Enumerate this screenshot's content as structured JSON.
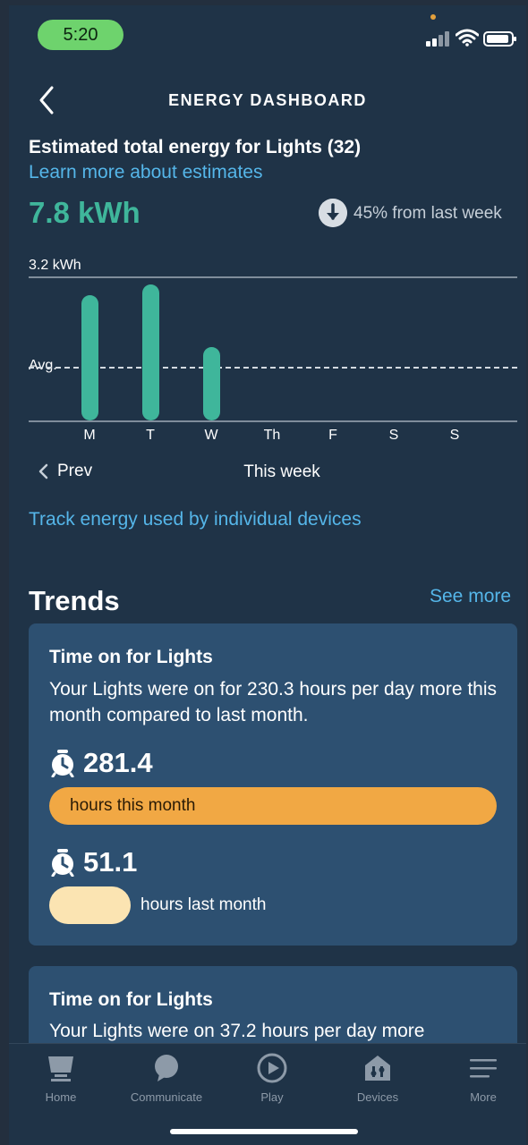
{
  "status_bar": {
    "time": "5:20"
  },
  "header": {
    "title": "ENERGY DASHBOARD"
  },
  "summary": {
    "title": "Estimated total energy for Lights (32)",
    "learn_link": "Learn more about estimates",
    "total": "7.8 kWh",
    "change_text": "45% from last week",
    "change_direction": "down"
  },
  "chart_data": {
    "type": "bar",
    "title": "",
    "max_label": "3.2 kWh",
    "avg_label": "Avg.",
    "categories": [
      "M",
      "T",
      "W",
      "Th",
      "F",
      "S",
      "S"
    ],
    "values": [
      2.8,
      3.05,
      1.65,
      0,
      0,
      0,
      0
    ],
    "average": 1.2,
    "ylim": [
      0,
      3.2
    ],
    "color": "#3fb69b"
  },
  "chart_nav": {
    "prev_label": "Prev",
    "period_label": "This week"
  },
  "track_link": "Track energy used by individual devices",
  "trends": {
    "title": "Trends",
    "see_more": "See more",
    "cards": [
      {
        "title": "Time on for Lights",
        "body": "Your Lights were on for 230.3 hours per day more this month compared to last month.",
        "this_value": "281.4",
        "this_label": "hours this month",
        "last_value": "51.1",
        "last_label": "hours last month"
      },
      {
        "title": "Time on for Lights",
        "body": "Your Lights were on 37.2 hours per day more"
      }
    ]
  },
  "tabbar": {
    "tabs": [
      {
        "label": "Home",
        "icon": "home-icon"
      },
      {
        "label": "Communicate",
        "icon": "chat-bubble-icon"
      },
      {
        "label": "Play",
        "icon": "play-icon"
      },
      {
        "label": "Devices",
        "icon": "devices-house-icon"
      },
      {
        "label": "More",
        "icon": "menu-icon"
      }
    ]
  },
  "colors": {
    "background": "#1f3347",
    "accent_green": "#3fb69b",
    "link_blue": "#55b6e9",
    "card": "#2d5071",
    "this_month_pill": "#f1a844",
    "last_month_pill": "#fbe4b2"
  }
}
